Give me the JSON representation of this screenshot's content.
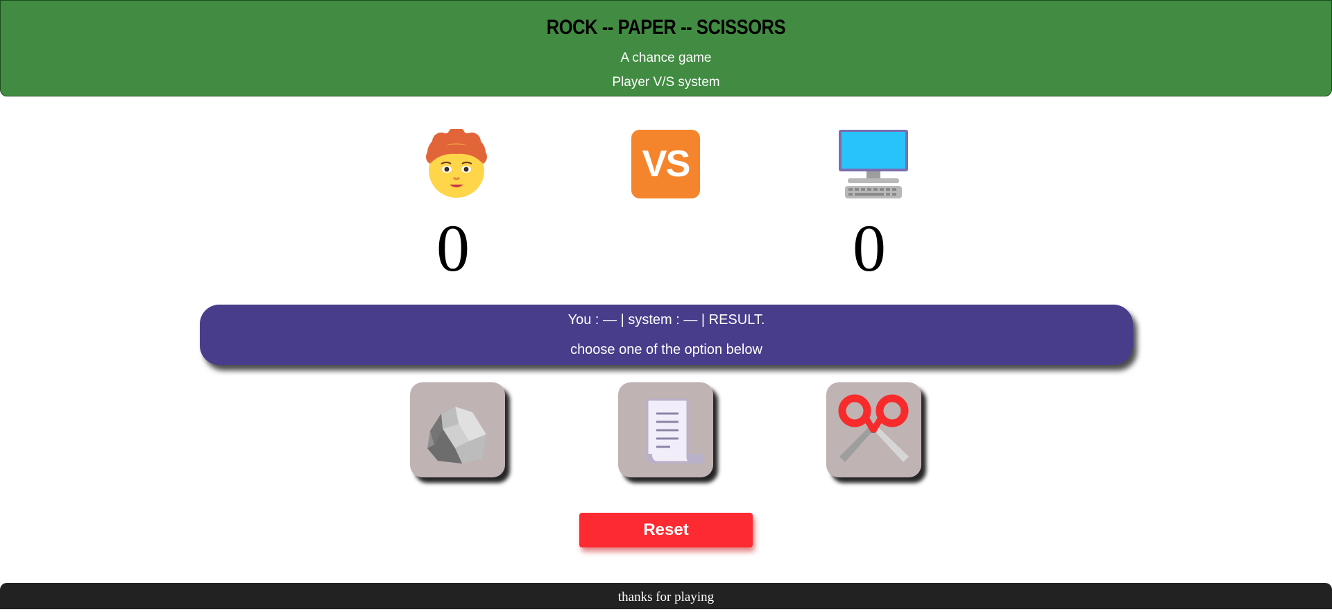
{
  "header": {
    "title": "ROCK -- PAPER -- SCISSORS",
    "subtitle": "A chance game",
    "subtitle2": "Player V/S system",
    "color": "#418c42"
  },
  "scoreboard": {
    "player_icon": "person-face-icon",
    "vs_label": "VS",
    "system_icon": "computer-icon",
    "player_score": "0",
    "system_score": "0"
  },
  "message": {
    "line1": "You : — | system : — | RESULT.",
    "line2": "choose one of the option below",
    "color": "#483d8b"
  },
  "choices": [
    {
      "name": "rock",
      "icon": "rock-icon"
    },
    {
      "name": "paper",
      "icon": "paper-scroll-icon"
    },
    {
      "name": "scissors",
      "icon": "scissors-icon"
    }
  ],
  "reset_label": "Reset",
  "footer": {
    "text": "thanks for playing"
  }
}
